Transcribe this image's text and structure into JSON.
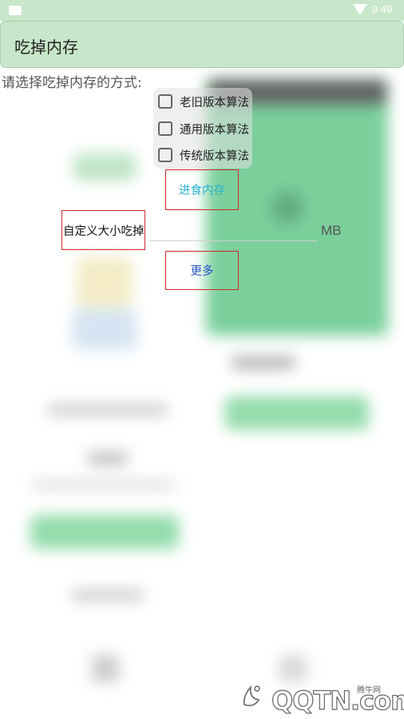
{
  "status_bar": {
    "time": "9:49",
    "colors": {
      "bar": "#c8e6c9"
    }
  },
  "title_bar": {
    "title": "吃掉内存",
    "background": "#c8e6c9"
  },
  "prompt": "请选择吃掉内存的方式:",
  "options": [
    {
      "label": "老旧版本算法",
      "checked": false
    },
    {
      "label": "通用版本算法",
      "checked": false
    },
    {
      "label": "传统版本算法",
      "checked": false
    }
  ],
  "eat_button": {
    "label": "进食内存",
    "color": "#2ab0d0"
  },
  "custom": {
    "button_label": "自定义大小吃掉",
    "input_value": "",
    "unit": "MB"
  },
  "more_button": {
    "label": "更多",
    "color": "#2b55c9"
  },
  "watermark": {
    "cn": "腾牛网",
    "text": "QQTN.com"
  }
}
